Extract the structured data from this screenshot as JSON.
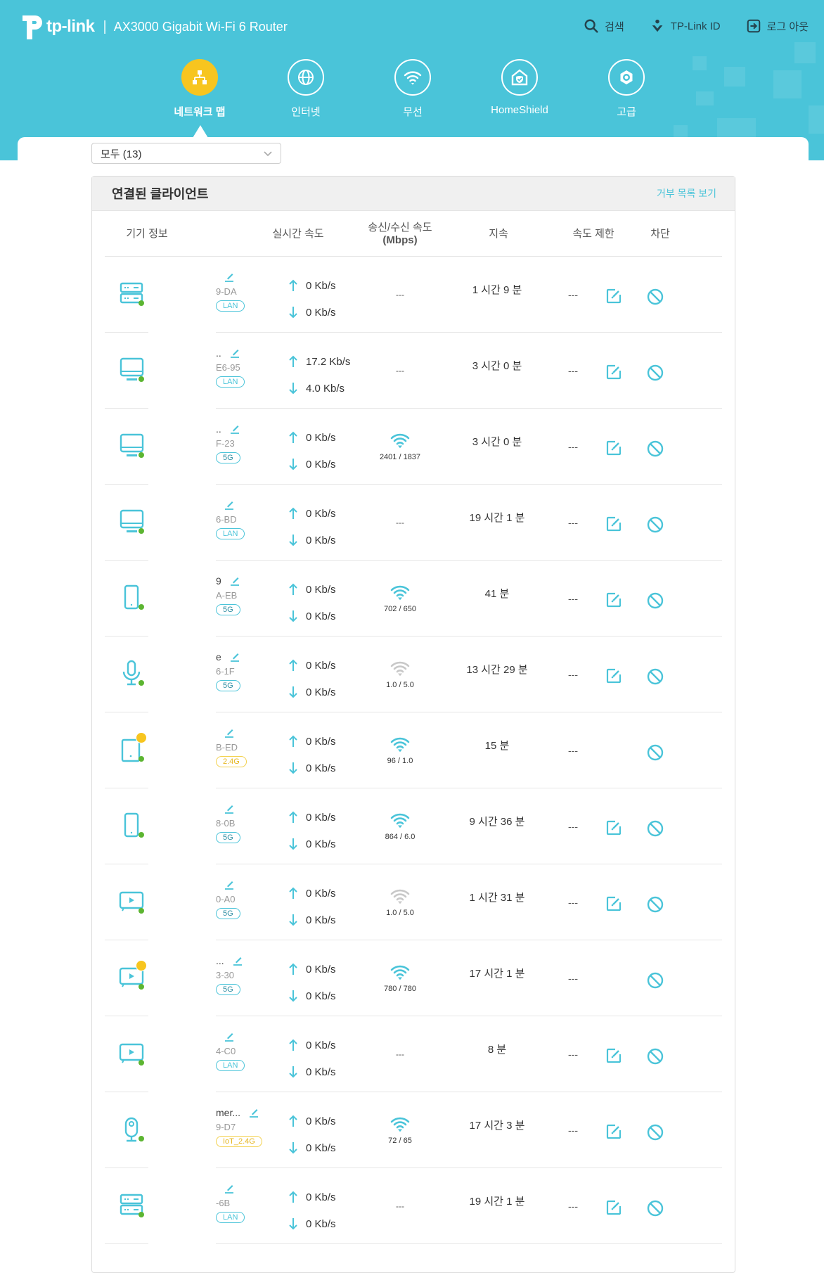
{
  "header": {
    "brand": "tp-link",
    "separator": "|",
    "product": "AX3000 Gigabit Wi-Fi 6 Router",
    "actions": [
      {
        "label": "검색",
        "icon": "search-icon"
      },
      {
        "label": "TP-Link ID",
        "icon": "user-id-icon"
      },
      {
        "label": "로그 아웃",
        "icon": "logout-icon"
      }
    ]
  },
  "nav": {
    "active": "네트워크 맵",
    "items": [
      {
        "label": "네트워크 맵",
        "icon": "network-map-icon",
        "active": true
      },
      {
        "label": "인터넷",
        "icon": "globe-icon",
        "active": false
      },
      {
        "label": "무선",
        "icon": "wifi-icon",
        "active": false
      },
      {
        "label": "HomeShield",
        "icon": "homeshield-icon",
        "active": false
      },
      {
        "label": "고급",
        "icon": "gear-icon",
        "active": false
      }
    ]
  },
  "filter": {
    "selected": "모두 (13)"
  },
  "panel": {
    "title": "연결된 클라이언트",
    "deny_list_link": "거부 목록 보기",
    "columns": {
      "device": "기기 정보",
      "realtime": "실시간 속도",
      "txrx_line1": "송신/수신 속도",
      "txrx_line2": "(Mbps)",
      "duration": "지속",
      "limit": "속도 제한",
      "block": "차단"
    },
    "colors": {
      "accent": "#4ac4d9",
      "online": "#5cb531",
      "iot": "#f7c51f",
      "wifi_weak": "#c8c8c8"
    },
    "rows": [
      {
        "type": "server",
        "name": "",
        "mac": "9-DA",
        "band": "LAN",
        "up": "0 Kb/s",
        "down": "0 Kb/s",
        "rate": "---",
        "signal": "none",
        "duration": "1 시간 9 분",
        "limit": "---",
        "can_edit_limit": true,
        "iot": false
      },
      {
        "type": "desktop",
        "name": "..",
        "mac": "E6-95",
        "band": "LAN",
        "up": "17.2 Kb/s",
        "down": "4.0 Kb/s",
        "rate": "---",
        "signal": "none",
        "duration": "3 시간 0 분",
        "limit": "---",
        "can_edit_limit": true,
        "iot": false
      },
      {
        "type": "desktop",
        "name": "..",
        "mac": "F-23",
        "band": "5G",
        "up": "0 Kb/s",
        "down": "0 Kb/s",
        "rate": "2401 / 1837",
        "signal": "strong",
        "duration": "3 시간 0 분",
        "limit": "---",
        "can_edit_limit": true,
        "iot": false
      },
      {
        "type": "desktop",
        "name": "",
        "mac": "6-BD",
        "band": "LAN",
        "up": "0 Kb/s",
        "down": "0 Kb/s",
        "rate": "---",
        "signal": "none",
        "duration": "19 시간 1 분",
        "limit": "---",
        "can_edit_limit": true,
        "iot": false
      },
      {
        "type": "phone",
        "name": "9",
        "mac": "A-EB",
        "band": "5G",
        "up": "0 Kb/s",
        "down": "0 Kb/s",
        "rate": "702 / 650",
        "signal": "strong",
        "duration": "41 분",
        "limit": "---",
        "can_edit_limit": true,
        "iot": false
      },
      {
        "type": "mic",
        "name": "e",
        "mac": "6-1F",
        "band": "5G",
        "up": "0 Kb/s",
        "down": "0 Kb/s",
        "rate": "1.0 / 5.0",
        "signal": "weak",
        "duration": "13 시간 29 분",
        "limit": "---",
        "can_edit_limit": true,
        "iot": false
      },
      {
        "type": "tablet",
        "name": "",
        "mac": "B-ED",
        "band": "2.4G",
        "up": "0 Kb/s",
        "down": "0 Kb/s",
        "rate": "96 / 1.0",
        "signal": "strong",
        "duration": "15 분",
        "limit": "---",
        "can_edit_limit": false,
        "iot": true
      },
      {
        "type": "phone",
        "name": "",
        "mac": "8-0B",
        "band": "5G",
        "up": "0 Kb/s",
        "down": "0 Kb/s",
        "rate": "864 / 6.0",
        "signal": "strong",
        "duration": "9 시간 36 분",
        "limit": "---",
        "can_edit_limit": true,
        "iot": false
      },
      {
        "type": "tv",
        "name": "",
        "mac": "0-A0",
        "band": "5G",
        "up": "0 Kb/s",
        "down": "0 Kb/s",
        "rate": "1.0 / 5.0",
        "signal": "weak",
        "duration": "1 시간 31 분",
        "limit": "---",
        "can_edit_limit": true,
        "iot": false
      },
      {
        "type": "tv",
        "name": "...",
        "mac": "3-30",
        "band": "5G",
        "up": "0 Kb/s",
        "down": "0 Kb/s",
        "rate": "780 / 780",
        "signal": "strong",
        "duration": "17 시간 1 분",
        "limit": "---",
        "can_edit_limit": false,
        "iot": true
      },
      {
        "type": "tv",
        "name": "",
        "mac": "4-C0",
        "band": "LAN",
        "up": "0 Kb/s",
        "down": "0 Kb/s",
        "rate": "---",
        "signal": "none",
        "duration": "8 분",
        "limit": "---",
        "can_edit_limit": true,
        "iot": false
      },
      {
        "type": "camera",
        "name": "mer...",
        "mac": "9-D7",
        "band": "IoT_2.4G",
        "up": "0 Kb/s",
        "down": "0 Kb/s",
        "rate": "72 / 65",
        "signal": "strong",
        "duration": "17 시간 3 분",
        "limit": "---",
        "can_edit_limit": true,
        "iot": false
      },
      {
        "type": "server",
        "name": "",
        "mac": "-6B",
        "band": "LAN",
        "up": "0 Kb/s",
        "down": "0 Kb/s",
        "rate": "---",
        "signal": "none",
        "duration": "19 시간 1 분",
        "limit": "---",
        "can_edit_limit": true,
        "iot": false
      }
    ]
  }
}
